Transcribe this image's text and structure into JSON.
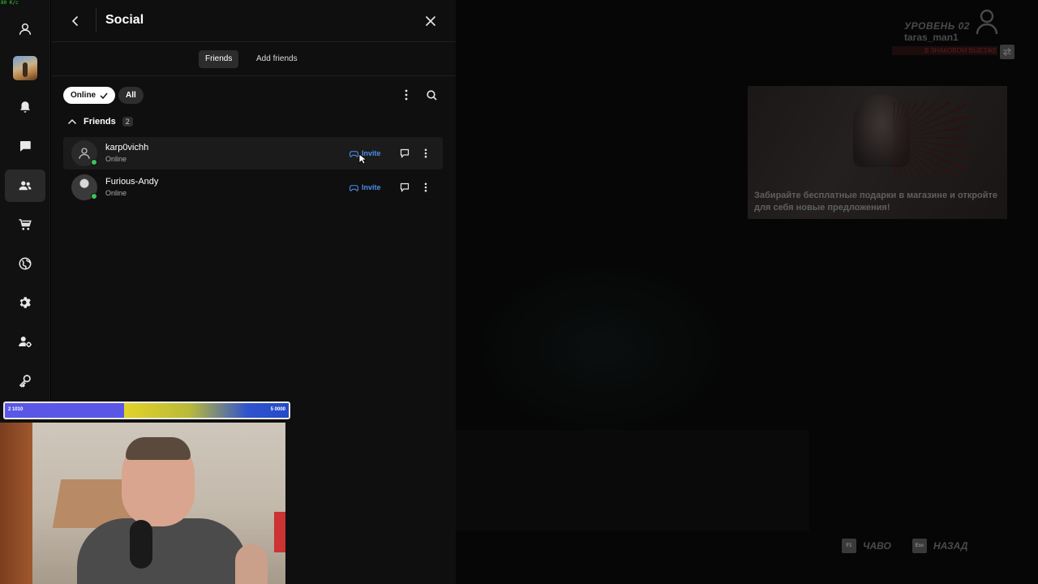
{
  "overlay": {
    "speed": "80 K/c"
  },
  "sidebar": {
    "items": [
      {
        "name": "profile",
        "icon": "user-icon"
      },
      {
        "name": "game",
        "icon": "game-thumbnail"
      },
      {
        "name": "notifications",
        "icon": "bell-icon"
      },
      {
        "name": "chat",
        "icon": "chat-bubble-icon"
      },
      {
        "name": "social",
        "icon": "friends-icon",
        "active": true
      },
      {
        "name": "store",
        "icon": "cart-icon"
      },
      {
        "name": "web",
        "icon": "globe-icon"
      },
      {
        "name": "settings",
        "icon": "gear-icon"
      },
      {
        "name": "account-settings",
        "icon": "user-gear-icon"
      },
      {
        "name": "keys",
        "icon": "key-icon"
      }
    ]
  },
  "panel": {
    "title": "Social",
    "tabs": [
      {
        "label": "Friends",
        "active": true
      },
      {
        "label": "Add friends",
        "active": false
      }
    ],
    "filters": {
      "online_label": "Online",
      "all_label": "All"
    },
    "section": {
      "title": "Friends",
      "count": "2"
    },
    "friends": [
      {
        "name": "karp0vichh",
        "status": "Online",
        "invite_label": "Invite",
        "avatar": "default"
      },
      {
        "name": "Furious-Andy",
        "status": "Online",
        "invite_label": "Invite",
        "avatar": "photo"
      }
    ]
  },
  "hud": {
    "level": "УРОВЕНЬ 02",
    "username": "taras_man1",
    "red_banner": "В ЗНАКОВОМ ВЫЕЗЖЕНИЕ",
    "promo_text": "Забирайте бесплатные подарки в магазине и откройте для себя новые предложения!",
    "keys": [
      {
        "key": "F1",
        "label": "ЧАВО"
      },
      {
        "key": "Esc",
        "label": "НАЗАД"
      }
    ]
  },
  "stream": {
    "donation_left": "2 1010",
    "donation_right": "5 0000",
    "donation_progress": 0.42
  },
  "colors": {
    "accent": "#4a8fe8",
    "online": "#3ec25a",
    "panel_bg": "#0f0f0f",
    "sidebar_bg": "#111111"
  }
}
